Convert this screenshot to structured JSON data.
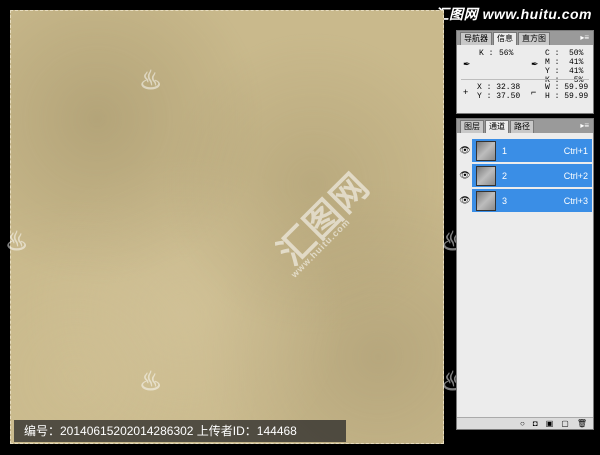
{
  "brand": "汇图网 www.huitu.com",
  "canvas_watermark": {
    "logo_text": "汇图网",
    "url_text": "www.huitu.com",
    "flame_glyph": "♨"
  },
  "caption": "编号：20140615202014286302 上传者ID：144468",
  "info_panel": {
    "tabs": [
      "导航器",
      "信息",
      "直方图"
    ],
    "active_tab": "信息",
    "k_label": "K :",
    "k_value": "56%",
    "cmyk_lines": "C :  50%\nM :  41%\nY :  41%\nK :   5%",
    "xy_lines": "X : 32.38\nY : 37.50",
    "wh_lines": "W : 59.99\nH : 59.99"
  },
  "layers_panel": {
    "tabs": [
      "图层",
      "通道",
      "路径"
    ],
    "active_tab": "通道",
    "channels": [
      {
        "name": "1",
        "shortcut": "Ctrl+1"
      },
      {
        "name": "2",
        "shortcut": "Ctrl+2"
      },
      {
        "name": "3",
        "shortcut": "Ctrl+3"
      }
    ],
    "footer_icons": [
      "○",
      "◘",
      "▣",
      "▢",
      "🗑"
    ]
  },
  "colors": {
    "canvas_base": "#c9b98c",
    "selection": "#3a8ee6",
    "panel_bg": "#ececec"
  }
}
